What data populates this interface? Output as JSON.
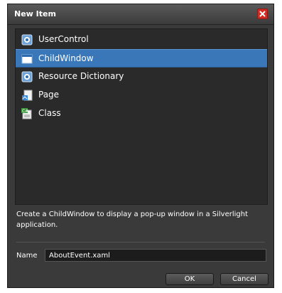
{
  "dialog": {
    "title": "New Item"
  },
  "items": [
    {
      "label": "UserControl",
      "icon": "xaml-file-icon",
      "selected": false
    },
    {
      "label": "ChildWindow",
      "icon": "window-icon",
      "selected": true
    },
    {
      "label": "Resource Dictionary",
      "icon": "xaml-file-icon",
      "selected": false
    },
    {
      "label": "Page",
      "icon": "page-icon",
      "selected": false
    },
    {
      "label": "Class",
      "icon": "csharp-class-icon",
      "selected": false
    }
  ],
  "description": "Create a ChildWindow to display a pop-up window in a Silverlight application.",
  "name_field": {
    "label": "Name",
    "value": "AboutEvent.xaml"
  },
  "buttons": {
    "ok": "OK",
    "cancel": "Cancel"
  },
  "colors": {
    "selection": "#3a77b8",
    "close": "#d32a22",
    "dialog_bg": "#3a3a3a"
  }
}
